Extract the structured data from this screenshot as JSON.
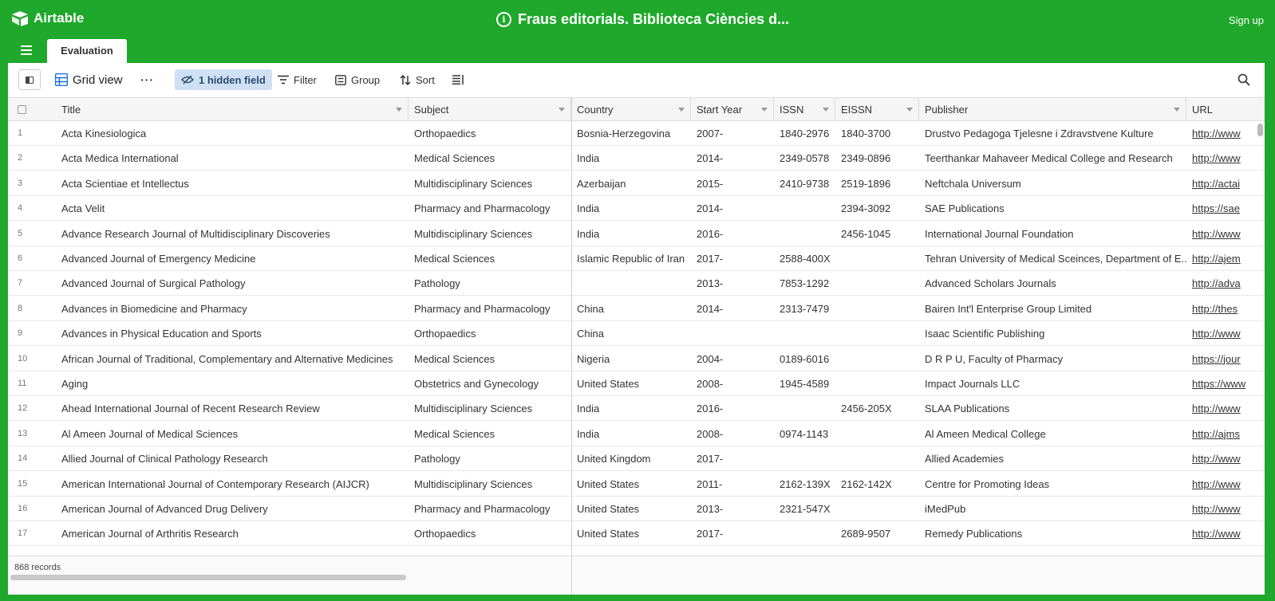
{
  "app": {
    "name": "Airtable",
    "signup": "Sign up"
  },
  "base": {
    "title": "Fraus editorials. Biblioteca Ciències d..."
  },
  "tabs": [
    {
      "label": "Evaluation"
    }
  ],
  "toolbar": {
    "view_label": "Grid view",
    "more": "···",
    "hidden_fields": "1 hidden field",
    "filter": "Filter",
    "group": "Group",
    "sort": "Sort"
  },
  "columns": [
    "Title",
    "Subject",
    "Country",
    "Start Year",
    "ISSN",
    "EISSN",
    "Publisher",
    "URL"
  ],
  "rows": [
    {
      "n": "1",
      "title": "Acta Kinesiologica",
      "subject": "Orthopaedics",
      "country": "Bosnia-Herzegovina",
      "start": "2007-",
      "issn": "1840-2976",
      "eissn": "1840-3700",
      "publisher": "Drustvo Pedagoga Tjelesne i Zdravstvene Kulture",
      "url": "http://www"
    },
    {
      "n": "2",
      "title": "Acta Medica International",
      "subject": "Medical Sciences",
      "country": "India",
      "start": "2014-",
      "issn": "2349-0578",
      "eissn": "2349-0896",
      "publisher": "Teerthankar Mahaveer Medical College and Research",
      "url": "http://www"
    },
    {
      "n": "3",
      "title": "Acta Scientiae et Intellectus",
      "subject": "Multidisciplinary Sciences",
      "country": "Azerbaijan",
      "start": "2015-",
      "issn": "2410-9738",
      "eissn": "2519-1896",
      "publisher": "Neftchala Universum",
      "url": "http://actai"
    },
    {
      "n": "4",
      "title": "Acta Velit",
      "subject": "Pharmacy and Pharmacology",
      "country": "India",
      "start": "2014-",
      "issn": "",
      "eissn": "2394-3092",
      "publisher": "SAE Publications",
      "url": "https://sae"
    },
    {
      "n": "5",
      "title": "Advance Research Journal of Multidisciplinary Discoveries",
      "subject": "Multidisciplinary Sciences",
      "country": "India",
      "start": "2016-",
      "issn": "",
      "eissn": "2456-1045",
      "publisher": "International Journal Foundation",
      "url": "http://www"
    },
    {
      "n": "6",
      "title": "Advanced Journal of Emergency Medicine",
      "subject": "Medical Sciences",
      "country": "Islamic Republic of Iran",
      "start": "2017-",
      "issn": "2588-400X",
      "eissn": "",
      "publisher": "Tehran University of Medical Sceinces, Department of E...",
      "url": "http://ajem"
    },
    {
      "n": "7",
      "title": "Advanced Journal of Surgical Pathology",
      "subject": "Pathology",
      "country": "",
      "start": "2013-",
      "issn": "7853-1292",
      "eissn": "",
      "publisher": "Advanced Scholars Journals",
      "url": "http://adva"
    },
    {
      "n": "8",
      "title": "Advances in Biomedicine and Pharmacy",
      "subject": "Pharmacy and Pharmacology",
      "country": "China",
      "start": "2014-",
      "issn": "2313-7479",
      "eissn": "",
      "publisher": "Bairen Int'l Enterprise Group Limited",
      "url": "http://thes"
    },
    {
      "n": "9",
      "title": "Advances in Physical Education and Sports",
      "subject": "Orthopaedics",
      "country": "China",
      "start": "",
      "issn": "",
      "eissn": "",
      "publisher": "Isaac Scientific Publishing",
      "url": "http://www"
    },
    {
      "n": "10",
      "title": "African Journal of Traditional, Complementary and Alternative Medicines",
      "subject": "Medical Sciences",
      "country": "Nigeria",
      "start": "2004-",
      "issn": "0189-6016",
      "eissn": "",
      "publisher": "D R P U, Faculty of Pharmacy",
      "url": "https://jour"
    },
    {
      "n": "11",
      "title": "Aging",
      "subject": "Obstetrics and Gynecology",
      "country": "United States",
      "start": "2008-",
      "issn": "1945-4589",
      "eissn": "",
      "publisher": "Impact Journals LLC",
      "url": "https://www"
    },
    {
      "n": "12",
      "title": "Ahead International Journal of Recent Research Review",
      "subject": "Multidisciplinary Sciences",
      "country": "India",
      "start": "2016-",
      "issn": "",
      "eissn": "2456-205X",
      "publisher": "SLAA Publications",
      "url": "http://www"
    },
    {
      "n": "13",
      "title": "Al Ameen Journal of Medical Sciences",
      "subject": "Medical Sciences",
      "country": "India",
      "start": "2008-",
      "issn": "0974-1143",
      "eissn": "",
      "publisher": "Al Ameen Medical College",
      "url": "http://ajms"
    },
    {
      "n": "14",
      "title": "Allied Journal of Clinical Pathology Research",
      "subject": "Pathology",
      "country": "United Kingdom",
      "start": "2017-",
      "issn": "",
      "eissn": "",
      "publisher": "Allied Academies",
      "url": "http://www"
    },
    {
      "n": "15",
      "title": "American International Journal of Contemporary Research (AIJCR)",
      "subject": "Multidisciplinary Sciences",
      "country": "United States",
      "start": "2011-",
      "issn": "2162-139X",
      "eissn": "2162-142X",
      "publisher": "Centre for Promoting Ideas",
      "url": "http://www"
    },
    {
      "n": "16",
      "title": "American Journal of Advanced Drug Delivery",
      "subject": "Pharmacy and Pharmacology",
      "country": "United States",
      "start": "2013-",
      "issn": "2321-547X",
      "eissn": "",
      "publisher": "iMedPub",
      "url": "http://www"
    },
    {
      "n": "17",
      "title": "American Journal of Arthritis Research",
      "subject": "Orthopaedics",
      "country": "United States",
      "start": "2017-",
      "issn": "",
      "eissn": "2689-9507",
      "publisher": "Remedy Publications",
      "url": "http://www"
    }
  ],
  "footer": {
    "records": "868 records"
  },
  "colors": {
    "brand": "#1fa82b",
    "hidden_field_bg": "#cfe0f5"
  }
}
